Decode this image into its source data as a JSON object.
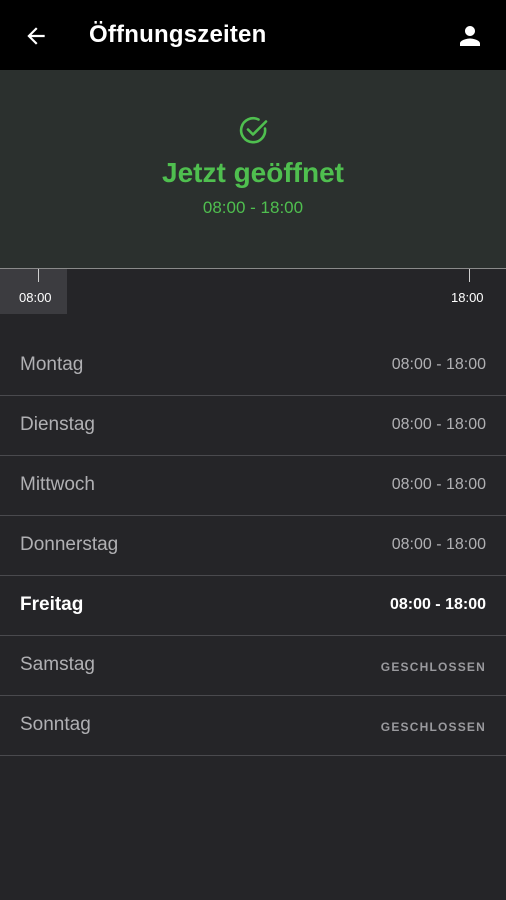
{
  "appbar": {
    "title": "Öffnungszeiten",
    "back_icon": "arrow-left-icon",
    "account_icon": "person-icon"
  },
  "status": {
    "icon": "check-circle-icon",
    "title": "Jetzt geöffnet",
    "hours": "08:00 - 18:00",
    "color": "#4fbf4f"
  },
  "timeline": {
    "start_label": "08:00",
    "end_label": "18:00"
  },
  "days": [
    {
      "name": "Montag",
      "hours": "08:00 - 18:00"
    },
    {
      "name": "Dienstag",
      "hours": "08:00 - 18:00"
    },
    {
      "name": "Mittwoch",
      "hours": "08:00 - 18:00"
    },
    {
      "name": "Donnerstag",
      "hours": "08:00 - 18:00"
    },
    {
      "name": "Freitag",
      "hours": "08:00 - 18:00",
      "today": true
    },
    {
      "name": "Samstag",
      "hours": "GESCHLOSSEN",
      "closed": true
    },
    {
      "name": "Sonntag",
      "hours": "GESCHLOSSEN",
      "closed": true
    }
  ]
}
